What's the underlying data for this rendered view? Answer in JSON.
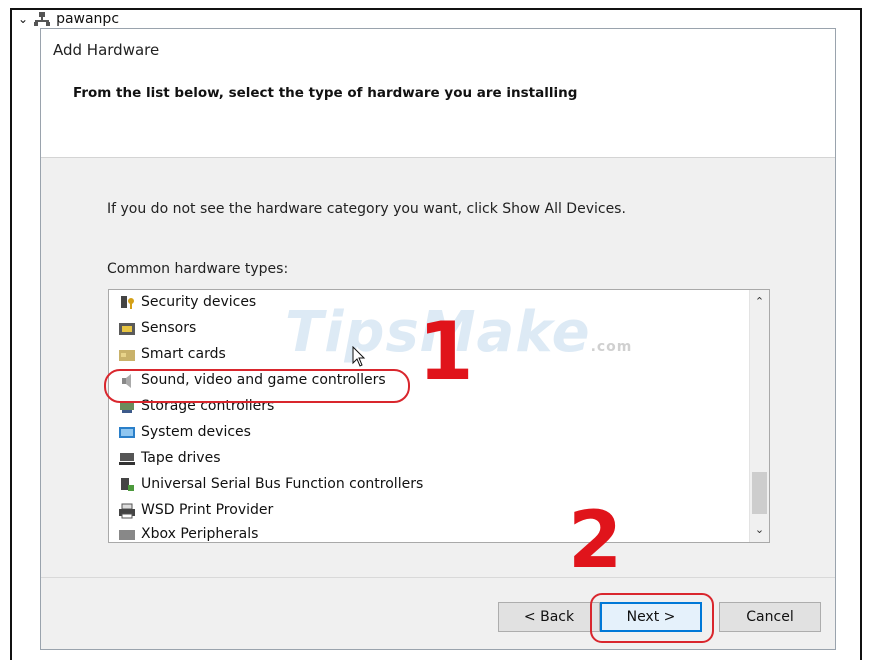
{
  "tree": {
    "node_label": "pawanpc"
  },
  "wizard": {
    "title": "Add Hardware",
    "subtitle": "From the list below, select the type of hardware you are installing",
    "hint": "If you do not see the hardware category you want, click Show All Devices.",
    "list_label": "Common hardware types:",
    "items": [
      {
        "label": "Security devices",
        "icon": "security-key-icon"
      },
      {
        "label": "Sensors",
        "icon": "sensor-icon"
      },
      {
        "label": "Smart cards",
        "icon": "smart-card-icon"
      },
      {
        "label": "Sound, video and game controllers",
        "icon": "speaker-icon"
      },
      {
        "label": "Storage controllers",
        "icon": "storage-controller-icon"
      },
      {
        "label": "System devices",
        "icon": "system-device-icon"
      },
      {
        "label": "Tape drives",
        "icon": "tape-drive-icon"
      },
      {
        "label": "Universal Serial Bus Function controllers",
        "icon": "usb-icon"
      },
      {
        "label": "WSD Print Provider",
        "icon": "printer-icon"
      },
      {
        "label": "Xbox Peripherals",
        "icon": "xbox-icon"
      }
    ],
    "buttons": {
      "back": "< Back",
      "next": "Next >",
      "cancel": "Cancel"
    }
  },
  "annotations": {
    "step1": "1",
    "step2": "2",
    "accent_color": "#e0141b"
  },
  "watermark": {
    "text": "TipsMake",
    "suffix": ".com"
  }
}
